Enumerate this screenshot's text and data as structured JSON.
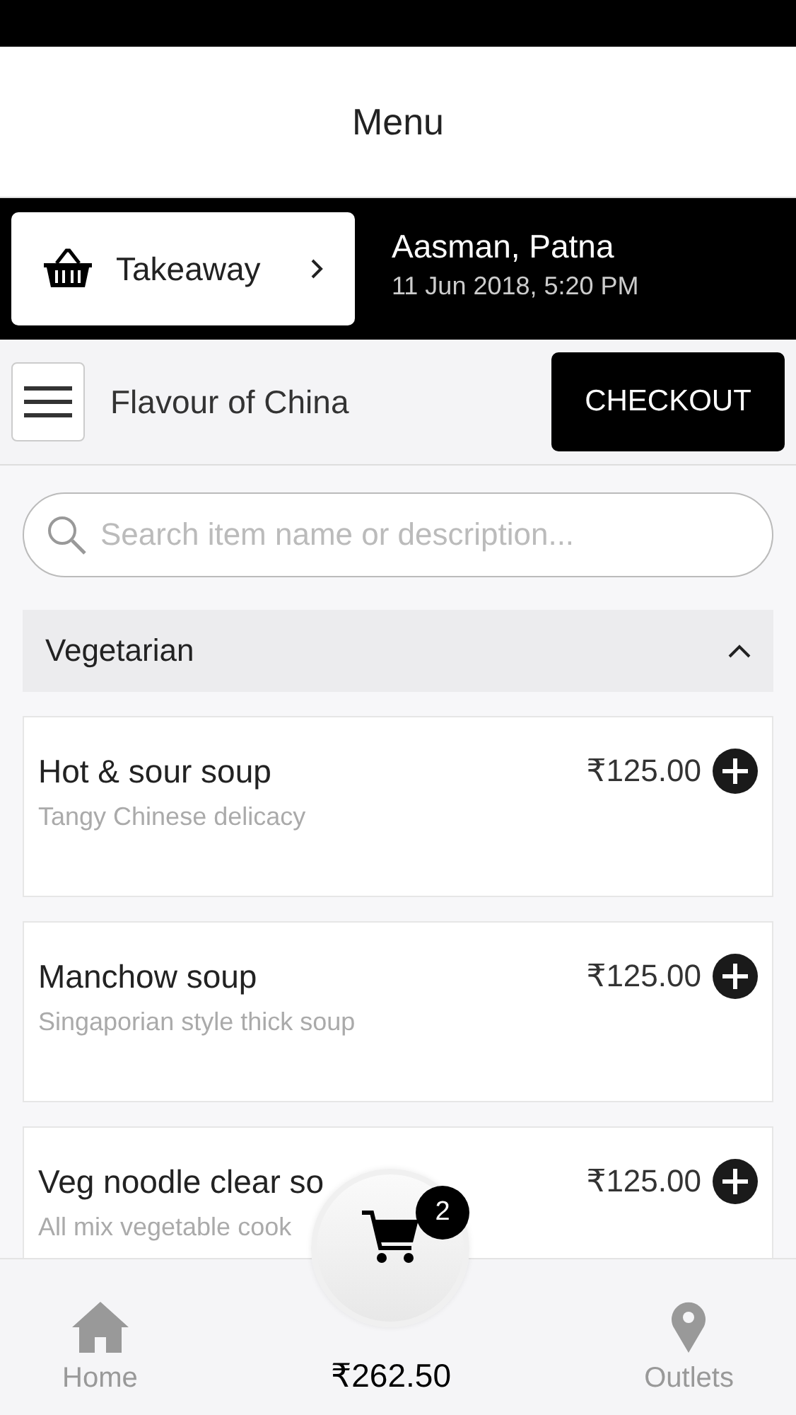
{
  "header": {
    "title": "Menu"
  },
  "order_type": {
    "label": "Takeaway"
  },
  "outlet": {
    "name": "Aasman, Patna",
    "datetime": "11 Jun 2018, 5:20 PM"
  },
  "restaurant": {
    "name": "Flavour of China"
  },
  "checkout": {
    "label": "CHECKOUT"
  },
  "search": {
    "placeholder": "Search item name or description..."
  },
  "section": {
    "title": "Vegetarian",
    "expanded": true
  },
  "items": [
    {
      "name": "Hot & sour soup",
      "price": "₹125.00",
      "description": "Tangy Chinese delicacy"
    },
    {
      "name": "Manchow soup",
      "price": "₹125.00",
      "description": "Singaporian style thick soup"
    },
    {
      "name": "Veg noodle clear so",
      "price": "₹125.00",
      "description": "All mix vegetable cook"
    }
  ],
  "bottom_nav": [
    {
      "kind": "home",
      "label": "Home"
    },
    {
      "kind": "cart",
      "label": "₹262.50",
      "count": "2"
    },
    {
      "kind": "outlets",
      "label": "Outlets"
    }
  ]
}
